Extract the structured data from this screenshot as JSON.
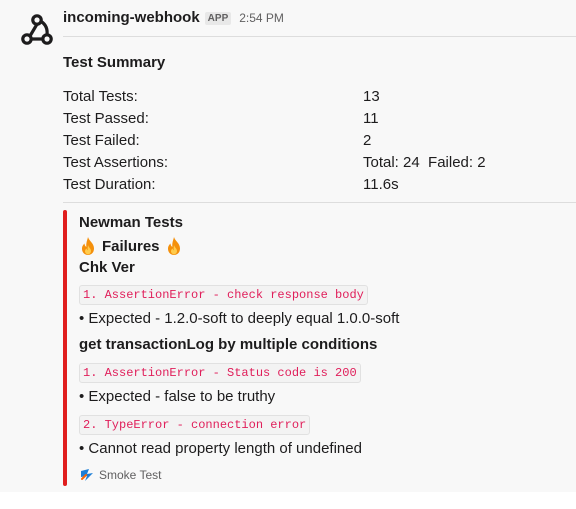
{
  "message": {
    "sender": "incoming-webhook",
    "badge": "APP",
    "time": "2:54 PM",
    "avatar_icon": "webhook-icon"
  },
  "summary": {
    "title": "Test Summary",
    "rows": [
      {
        "label": "Total Tests:",
        "value": "13"
      },
      {
        "label": "Test Passed:",
        "value": "11"
      },
      {
        "label": "Test Failed:",
        "value": "2"
      },
      {
        "label": "Test Assertions:",
        "value": "Total: 24  Failed: 2"
      },
      {
        "label": "Test Duration:",
        "value": "11.6s"
      }
    ]
  },
  "attachment": {
    "color": "#e01e1e",
    "title": "Newman Tests",
    "failures_label": "Failures",
    "failures_icon": "fire-icon",
    "groups": [
      {
        "name": "Chk Ver",
        "errors": [
          {
            "code": "1. AssertionError - check response body",
            "detail": "• Expected - 1.2.0-soft to deeply equal 1.0.0-soft"
          }
        ]
      },
      {
        "name": "get transactionLog by multiple conditions",
        "errors": [
          {
            "code": "1. AssertionError - Status code is 200",
            "detail": "• Expected - false to be truthy"
          },
          {
            "code": "2. TypeError - connection error",
            "detail": "• Cannot read property length of undefined"
          }
        ]
      }
    ],
    "footer": {
      "icon": "postman-icon",
      "text": "Smoke Test"
    }
  }
}
